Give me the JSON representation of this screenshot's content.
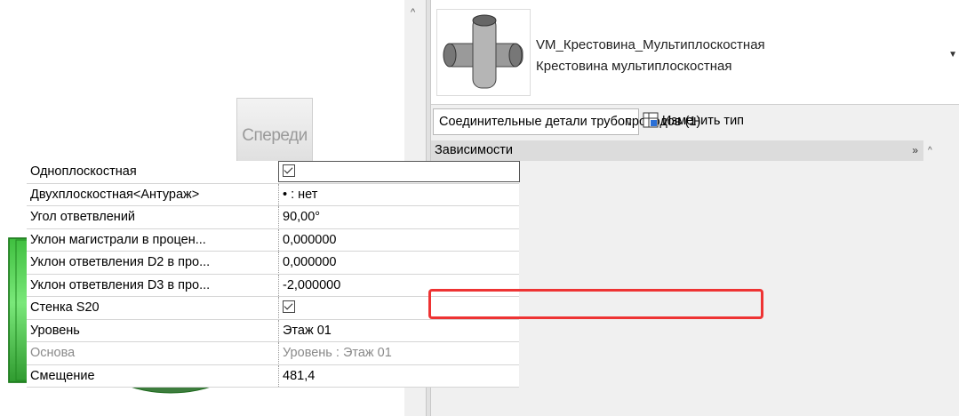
{
  "viewport": {
    "viewcube_label": "Спереди"
  },
  "type_selector": {
    "name": "VM_Крестовина_Мультиплоскостная",
    "subtitle": "Крестовина мультиплоскостная"
  },
  "filter": {
    "selected": "Соединительные детали трубопроводов (1)",
    "edit_type_label": "Изменить тип"
  },
  "group": {
    "label": "Зависимости"
  },
  "properties": [
    {
      "name": "Одноплоскостная",
      "value": "",
      "checked": true
    },
    {
      "name": "Двухплоскостная<Антураж>",
      "value": "• : нет"
    },
    {
      "name": "Угол ответвлений",
      "value": "90,00°"
    },
    {
      "name": "Уклон магистрали в процен...",
      "value": "0,000000"
    },
    {
      "name": "Уклон ответвления D2 в про...",
      "value": "0,000000"
    },
    {
      "name": "Уклон ответвления D3 в про...",
      "value": "-2,000000"
    },
    {
      "name": "Стенка S20",
      "value": "",
      "checked": true
    },
    {
      "name": "Уровень",
      "value": "Этаж 01"
    },
    {
      "name": "Основа",
      "value": "Уровень : Этаж 01",
      "muted": true
    },
    {
      "name": "Смещение",
      "value": "481,4"
    }
  ],
  "colors": {
    "highlight": "#e33333",
    "pipe_green": "#55d855",
    "pipe_dark": "#3c3c3c"
  }
}
